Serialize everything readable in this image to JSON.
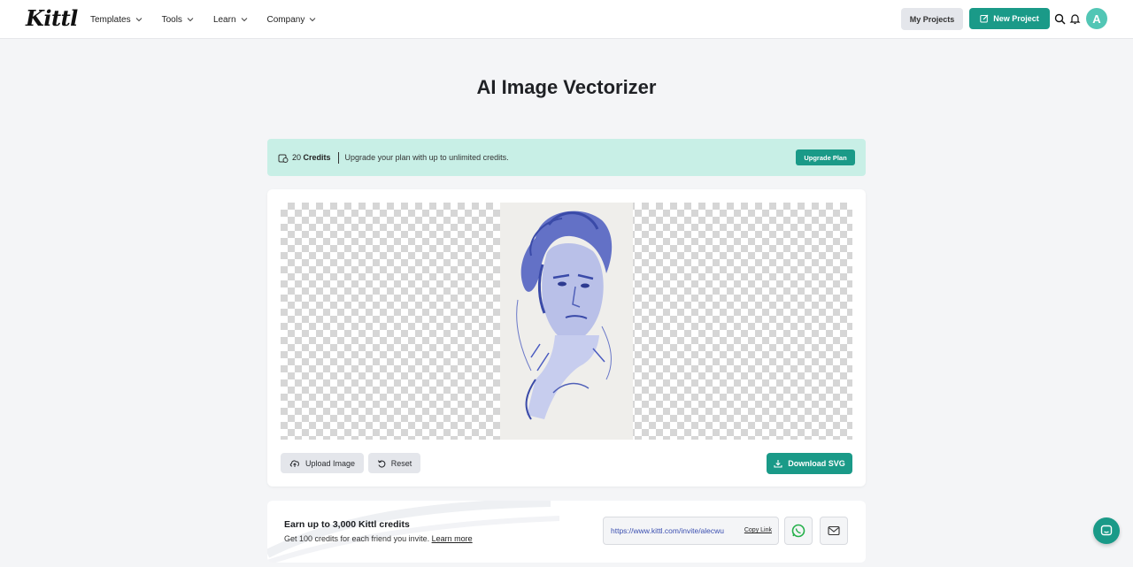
{
  "header": {
    "logo": "Kittl",
    "nav": [
      {
        "label": "Templates"
      },
      {
        "label": "Tools"
      },
      {
        "label": "Learn"
      },
      {
        "label": "Company"
      }
    ],
    "my_projects": "My Projects",
    "new_project": "New Project",
    "avatar_initial": "A"
  },
  "page": {
    "title": "AI Image Vectorizer"
  },
  "credits": {
    "count": "20",
    "unit": "Credits",
    "message": "Upgrade your plan with up to unlimited credits.",
    "upgrade_label": "Upgrade Plan"
  },
  "editor": {
    "upload_label": "Upload Image",
    "reset_label": "Reset",
    "download_label": "Download SVG"
  },
  "referral": {
    "title": "Earn up to 3,000 Kittl credits",
    "subtitle": "Get 100 credits for each friend you invite.",
    "learn_more": "Learn more",
    "invite_url": "https://www.kittl.com/invite/alecwu",
    "copy_link": "Copy Link"
  },
  "colors": {
    "accent": "#1a9a88",
    "banner": "#c8efe6",
    "avatar": "#52c6b5"
  }
}
